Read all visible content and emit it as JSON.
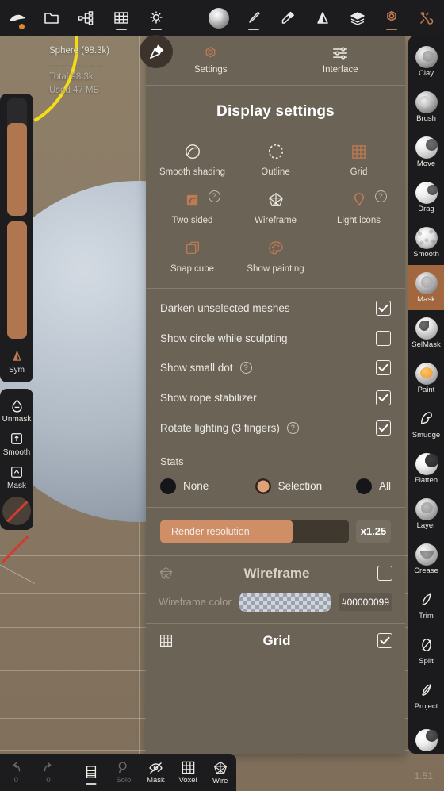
{
  "top_toolbar": {
    "items": [
      {
        "name": "sculpt-logo-icon",
        "icon": "logo",
        "label": ""
      },
      {
        "name": "files-icon",
        "icon": "folder",
        "label": ""
      },
      {
        "name": "scene-graph-icon",
        "icon": "nodes",
        "label": ""
      },
      {
        "name": "topology-grid-icon",
        "icon": "grid",
        "label": ""
      },
      {
        "name": "lighting-icon",
        "icon": "sun",
        "label": ""
      },
      {
        "name": "material-icon",
        "icon": "matcap",
        "label": ""
      },
      {
        "name": "brush-icon",
        "icon": "brush",
        "label": ""
      },
      {
        "name": "paint-fill-icon",
        "icon": "fill",
        "label": ""
      },
      {
        "name": "symmetry-icon",
        "icon": "mirror",
        "label": ""
      },
      {
        "name": "layers-icon",
        "icon": "layers",
        "label": ""
      },
      {
        "name": "settings-icon",
        "icon": "gear",
        "label": ""
      },
      {
        "name": "tools-icon",
        "icon": "wrench",
        "label": ""
      }
    ]
  },
  "mesh_info": {
    "name": "Sphere (98.3k)",
    "dashes": "- - - - - - - -",
    "total": "Total 98.3k",
    "used": "Used 47 MB"
  },
  "panel": {
    "tabs": [
      {
        "label": "Settings",
        "icon": "gear",
        "active": true
      },
      {
        "label": "Interface",
        "icon": "sliders",
        "active": false
      }
    ],
    "title": "Display settings",
    "display_toggles": [
      {
        "label": "Smooth shading",
        "icon": "smooth-shading",
        "accent": false,
        "help": false
      },
      {
        "label": "Outline",
        "icon": "outline",
        "accent": false,
        "help": false
      },
      {
        "label": "Grid",
        "icon": "grid",
        "accent": true,
        "help": false
      },
      {
        "label": "Two sided",
        "icon": "two-sided",
        "accent": true,
        "help": true
      },
      {
        "label": "Wireframe",
        "icon": "wireframe",
        "accent": false,
        "help": false
      },
      {
        "label": "Light icons",
        "icon": "light-bulb",
        "accent": true,
        "help": true
      },
      {
        "label": "Snap cube",
        "icon": "snap-cube",
        "accent": true,
        "help": false
      },
      {
        "label": "Show painting",
        "icon": "palette",
        "accent": true,
        "help": false
      }
    ],
    "checkbox_rows": [
      {
        "label": "Darken unselected meshes",
        "checked": true,
        "help": false
      },
      {
        "label": "Show circle while sculpting",
        "checked": false,
        "help": false
      },
      {
        "label": "Show small dot",
        "checked": true,
        "help": true
      },
      {
        "label": "Show rope stabilizer",
        "checked": true,
        "help": false
      },
      {
        "label": "Rotate lighting (3 fingers)",
        "checked": true,
        "help": true
      }
    ],
    "stats": {
      "label": "Stats",
      "options": [
        {
          "label": "None",
          "selected": false
        },
        {
          "label": "Selection",
          "selected": true
        },
        {
          "label": "All",
          "selected": false
        }
      ]
    },
    "render_resolution": {
      "label": "Render resolution",
      "value": "x1.25",
      "fill_percent": 70
    },
    "wireframe_section": {
      "title": "Wireframe",
      "checked": false,
      "color_label": "Wireframe color",
      "color_hex": "#00000099"
    },
    "grid_section": {
      "title": "Grid",
      "checked": true
    }
  },
  "left_sidebar": {
    "radius_slider": {
      "name": "radius-slider",
      "fill_percent": 79
    },
    "intensity_slider": {
      "name": "intensity-slider",
      "fill_percent": 100
    },
    "tools": [
      {
        "label": "Sym",
        "icon": "symmetry",
        "accent": true
      },
      {
        "label": "Unmask",
        "icon": "drop",
        "accent": false
      },
      {
        "label": "Smooth",
        "icon": "key-up",
        "accent": false
      },
      {
        "label": "Mask",
        "icon": "key-caret",
        "accent": false
      }
    ]
  },
  "right_sidebar": {
    "tools": [
      {
        "label": "Clay",
        "style": "clay",
        "selected": false
      },
      {
        "label": "Brush",
        "style": "brush",
        "selected": false
      },
      {
        "label": "Move",
        "style": "move",
        "selected": false
      },
      {
        "label": "Drag",
        "style": "drag",
        "selected": false
      },
      {
        "label": "Smooth",
        "style": "smooth",
        "selected": false
      },
      {
        "label": "Mask",
        "style": "mask",
        "selected": true
      },
      {
        "label": "SelMask",
        "style": "selmask",
        "selected": false
      },
      {
        "label": "Paint",
        "style": "paint",
        "selected": false
      },
      {
        "label": "Smudge",
        "style": "icon-smudge",
        "selected": false
      },
      {
        "label": "Flatten",
        "style": "flatten",
        "selected": false
      },
      {
        "label": "Layer",
        "style": "layer",
        "selected": false
      },
      {
        "label": "Crease",
        "style": "crease",
        "selected": false
      },
      {
        "label": "Trim",
        "style": "icon-trim",
        "selected": false
      },
      {
        "label": "Split",
        "style": "icon-split",
        "selected": false
      },
      {
        "label": "Project",
        "style": "icon-project",
        "selected": false
      },
      {
        "label": "",
        "style": "last",
        "selected": false
      }
    ]
  },
  "bottom_bar": {
    "undo": {
      "label": "0",
      "icon": "undo"
    },
    "redo": {
      "label": "0",
      "icon": "redo"
    },
    "items": [
      {
        "label": "",
        "icon": "layers-panel",
        "dim": false,
        "underline": true
      },
      {
        "label": "Solo",
        "icon": "magnifier",
        "dim": true,
        "underline": false
      },
      {
        "label": "Mask",
        "icon": "eye-slash",
        "dim": false,
        "underline": false
      },
      {
        "label": "Voxel",
        "icon": "grid",
        "dim": false,
        "underline": false
      },
      {
        "label": "Wire",
        "icon": "wireframe",
        "dim": false,
        "underline": false
      }
    ]
  },
  "clock": "1.51",
  "colors": {
    "accent": "#c07a53",
    "panel_bg": "#6b6356",
    "dark_bg": "#1c1c1e",
    "viewport_bg": "#8a7a66",
    "selected_tool": "#a3673f"
  }
}
